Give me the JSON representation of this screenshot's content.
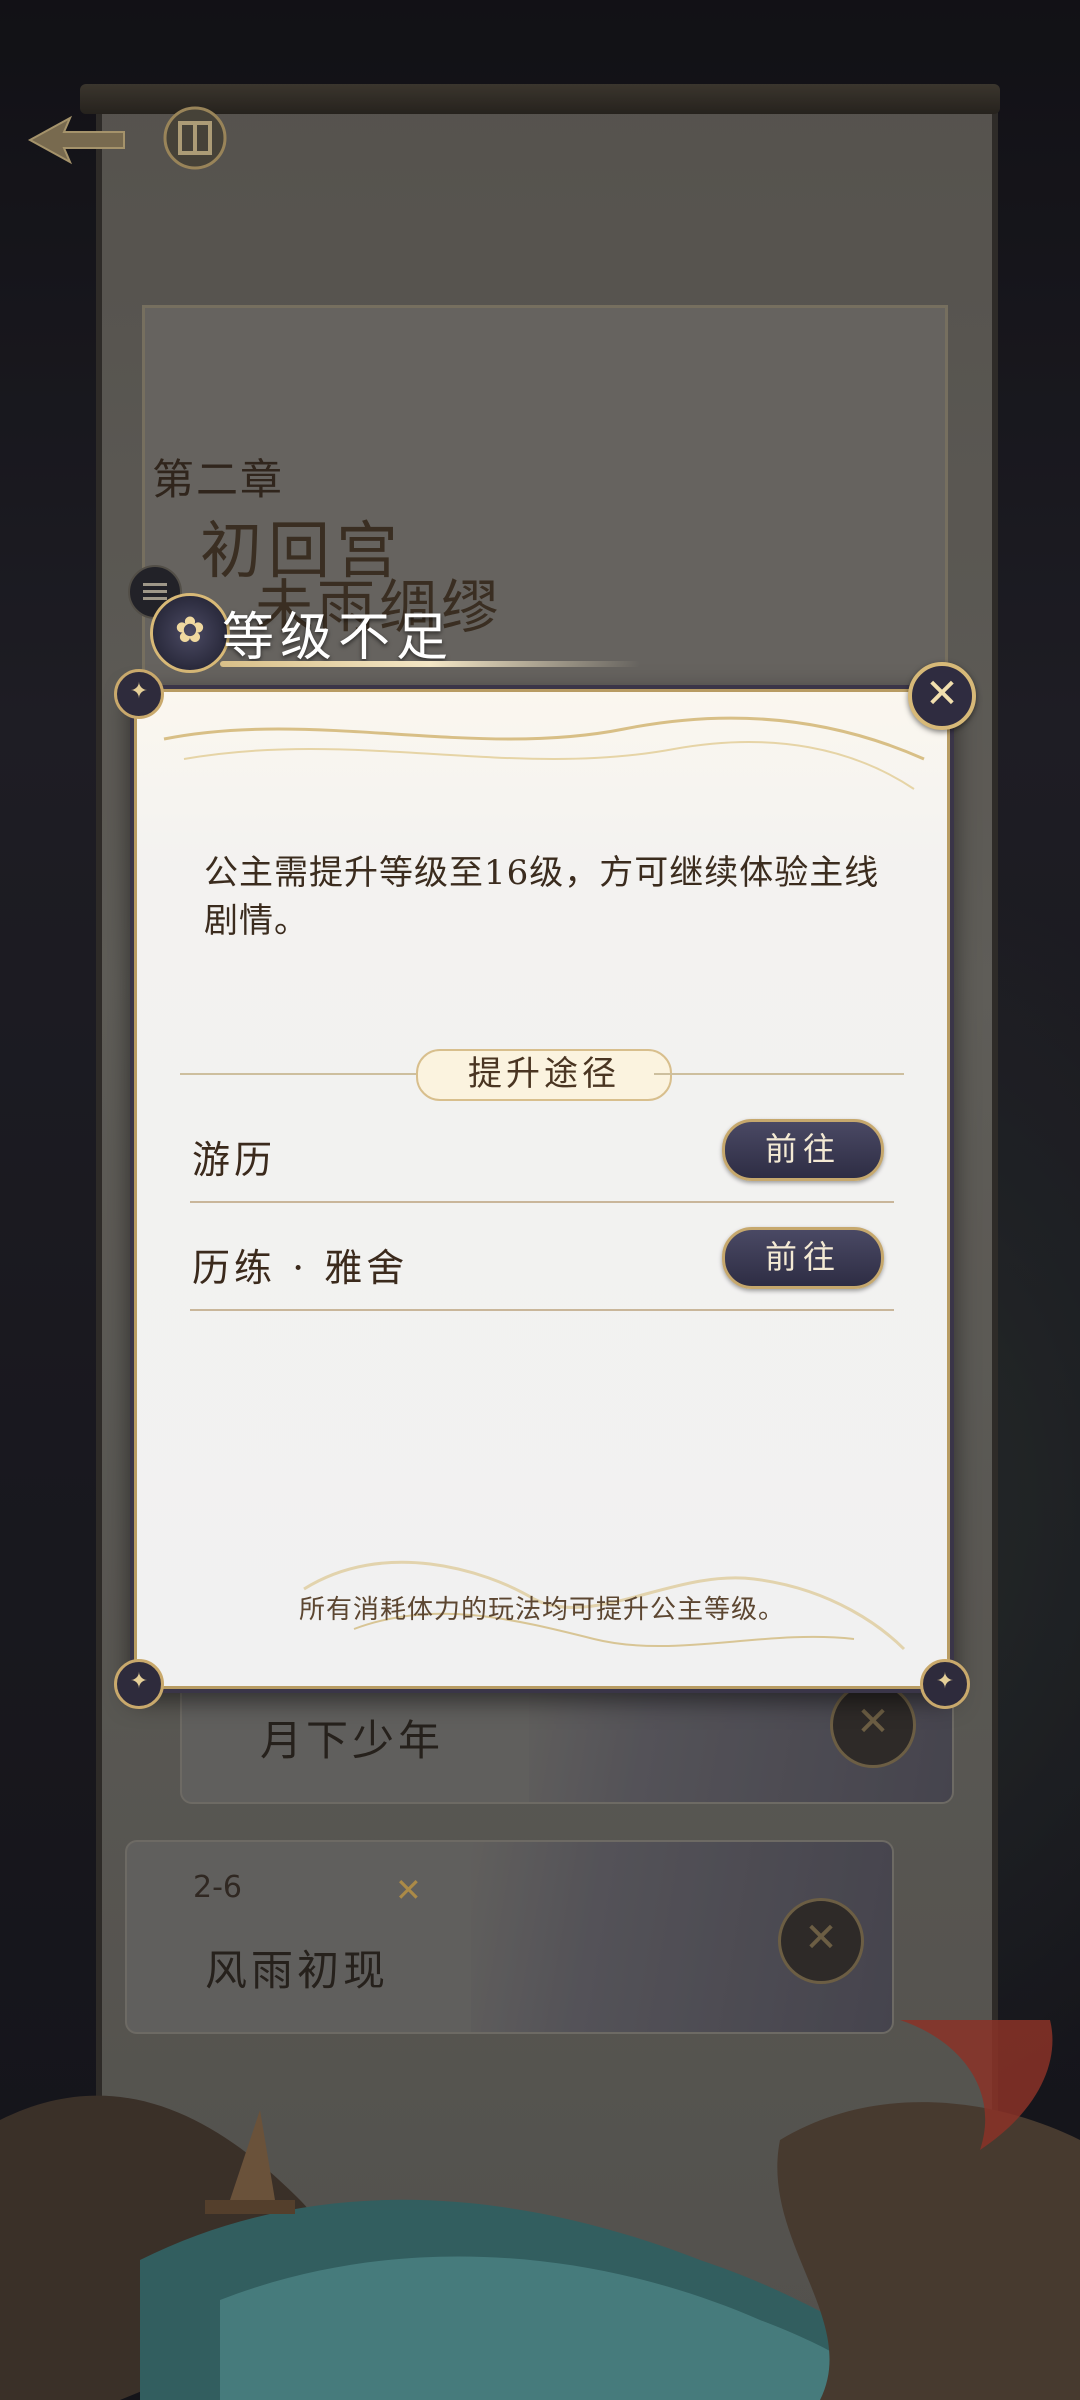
{
  "background": {
    "chapter_index": "第二章",
    "chapter_title": "初回宫",
    "chapter_subtitle": "未雨绸缪",
    "levels": [
      {
        "name": "月下少年"
      },
      {
        "code": "2-6",
        "name": "风雨初现"
      }
    ]
  },
  "dialog": {
    "title": "等级不足",
    "message": "公主需提升等级至16级，方可继续体验主线剧情。",
    "section_label": "提升途径",
    "routes": [
      {
        "name": "游历",
        "button": "前往"
      },
      {
        "name": "历练 · 雅舍",
        "button": "前往"
      }
    ],
    "footer": "所有消耗体力的玩法均可提升公主等级。"
  },
  "icons": {
    "back": "back-arrow-icon",
    "home": "home-icon",
    "menu": "menu-icon",
    "close": "close-icon"
  },
  "colors": {
    "accent_gold": "#c6a86d",
    "button_navy": "#2e2d44",
    "dialog_bg": "#f1f1f1"
  }
}
